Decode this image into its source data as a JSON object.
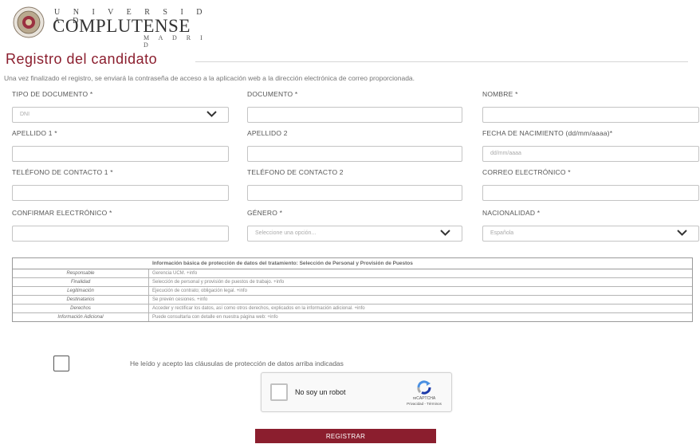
{
  "logo": {
    "top": "U N I V E R S I D A D",
    "main": "COMPLUTENSE",
    "bottom": "M A D R I D"
  },
  "page": {
    "title": "Registro del candidato",
    "intro": "Una vez finalizado el registro, se enviará la contraseña de acceso a la aplicación web a la dirección electrónica de correo proporcionada."
  },
  "form": {
    "tipo_documento": {
      "label": "TIPO DE DOCUMENTO *",
      "value": "DNI"
    },
    "documento": {
      "label": "DOCUMENTO *",
      "value": ""
    },
    "nombre": {
      "label": "NOMBRE *",
      "value": ""
    },
    "apellido1": {
      "label": "APELLIDO 1 *",
      "value": ""
    },
    "apellido2": {
      "label": "APELLIDO 2",
      "value": ""
    },
    "fecha_nacimiento": {
      "label": "FECHA DE NACIMIENTO (dd/mm/aaaa)*",
      "placeholder": "dd/mm/aaaa"
    },
    "telefono1": {
      "label": "TELÉFONO DE CONTACTO 1 *",
      "value": ""
    },
    "telefono2": {
      "label": "TELÉFONO DE CONTACTO 2",
      "value": ""
    },
    "correo": {
      "label": "CORREO ELECTRÓNICO *",
      "value": ""
    },
    "confirmar": {
      "label": "CONFIRMAR ELECTRÓNICO *",
      "value": ""
    },
    "genero": {
      "label": "GÉNERO *",
      "value": "Seleccione una opción..."
    },
    "nacionalidad": {
      "label": "NACIONALIDAD *",
      "value": "Española"
    }
  },
  "data_protection": {
    "heading": "Información básica de protección de datos del tratamiento: Selección de Personal y Provisión de Puestos",
    "rows": [
      {
        "key": "Responsable",
        "value": "Gerencia UCM. +info"
      },
      {
        "key": "Finalidad",
        "value": "Selección de personal y provisión de puestos de trabajo. +info"
      },
      {
        "key": "Legitimación",
        "value": "Ejecución de contrato; obligación legal. +info"
      },
      {
        "key": "Destinatarios",
        "value": "Se prevén cesiones. +info"
      },
      {
        "key": "Derechos",
        "value": "Acceder y rectificar los datos, así como otros derechos, explicados en la información adicional. +info"
      },
      {
        "key": "Información Adicional",
        "value": "Puede consultarla con detalle en nuestra página web: +info"
      }
    ]
  },
  "consent": {
    "label": "He leído y acepto las cláusulas de protección de datos arriba indicadas"
  },
  "captcha": {
    "label": "No soy un robot",
    "brand": "reCAPTCHA",
    "links": "Privacidad - Términos"
  },
  "submit": {
    "label": "REGISTRAR"
  },
  "colors": {
    "accent": "#8b1e2e",
    "border": "#c4c4c4"
  },
  "icons": {
    "select_arrow": "chevron-down-icon",
    "seal": "university-seal-icon",
    "captcha": "recaptcha-logo-icon"
  }
}
